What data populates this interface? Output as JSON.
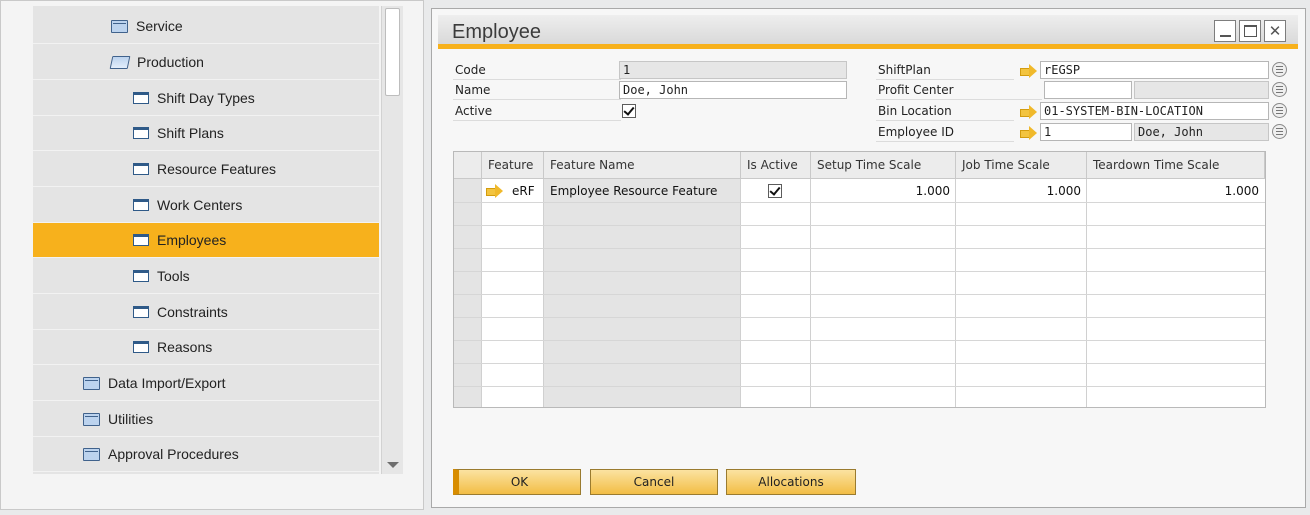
{
  "nav": {
    "items": [
      {
        "label": "Service",
        "icon": "folder-icon"
      },
      {
        "label": "Production",
        "icon": "folder-open-icon"
      },
      {
        "label": "Shift Day Types",
        "icon": "form-icon"
      },
      {
        "label": "Shift Plans",
        "icon": "form-icon"
      },
      {
        "label": "Resource Features",
        "icon": "form-icon"
      },
      {
        "label": "Work Centers",
        "icon": "form-icon"
      },
      {
        "label": "Employees",
        "icon": "form-icon",
        "selected": true
      },
      {
        "label": "Tools",
        "icon": "form-icon"
      },
      {
        "label": "Constraints",
        "icon": "form-icon"
      },
      {
        "label": "Reasons",
        "icon": "form-icon"
      },
      {
        "label": "Data Import/Export",
        "icon": "folder-icon"
      },
      {
        "label": "Utilities",
        "icon": "folder-icon"
      },
      {
        "label": "Approval Procedures",
        "icon": "folder-icon"
      }
    ]
  },
  "window": {
    "title": "Employee",
    "accent_color": "#f7b11c"
  },
  "form": {
    "code_label": "Code",
    "code_value": "1",
    "name_label": "Name",
    "name_value": "Doe, John",
    "active_label": "Active",
    "active_checked": true,
    "shiftplan_label": "ShiftPlan",
    "shiftplan_value": "rEGSP",
    "profit_center_label": "Profit Center",
    "profit_center_value": "",
    "profit_center_name": "",
    "bin_location_label": "Bin Location",
    "bin_location_value": "01-SYSTEM-BIN-LOCATION",
    "employee_id_label": "Employee ID",
    "employee_id_value": "1",
    "employee_id_name": "Doe, John"
  },
  "grid": {
    "columns": [
      "Feature",
      "Feature Name",
      "Is Active",
      "Setup Time Scale",
      "Job Time Scale",
      "Teardown Time Scale"
    ],
    "rows": [
      {
        "feature": "eRF",
        "feature_name": "Employee Resource Feature",
        "is_active": true,
        "setup_time_scale": "1.000",
        "job_time_scale": "1.000",
        "teardown_time_scale": "1.000"
      }
    ]
  },
  "buttons": {
    "ok": "OK",
    "cancel": "Cancel",
    "allocations": "Allocations"
  }
}
